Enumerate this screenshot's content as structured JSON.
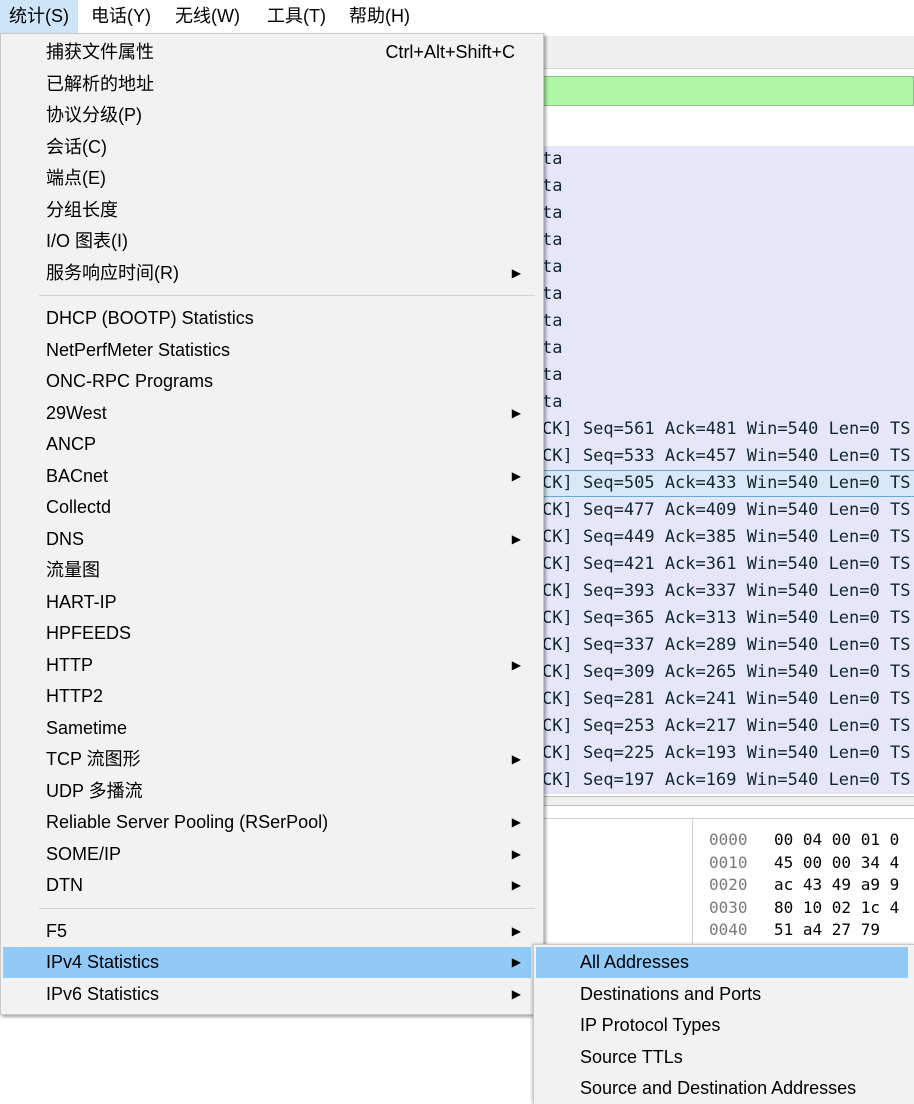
{
  "menubar": {
    "items": [
      {
        "label": "统计(S)",
        "active": true
      },
      {
        "label": "电话(Y)"
      },
      {
        "label": "无线(W)"
      },
      {
        "label": "工具(T)"
      },
      {
        "label": "帮助(H)"
      }
    ]
  },
  "statistics_menu": {
    "groups": [
      [
        {
          "label": "捕获文件属性",
          "shortcut": "Ctrl+Alt+Shift+C"
        },
        {
          "label": "已解析的地址"
        },
        {
          "label": "协议分级(P)"
        },
        {
          "label": "会话(C)"
        },
        {
          "label": "端点(E)"
        },
        {
          "label": "分组长度"
        },
        {
          "label": "I/O 图表(I)"
        },
        {
          "label": "服务响应时间(R)",
          "submenu": true
        }
      ],
      [
        {
          "label": "DHCP (BOOTP) Statistics"
        },
        {
          "label": "NetPerfMeter Statistics"
        },
        {
          "label": "ONC-RPC Programs"
        },
        {
          "label": "29West",
          "submenu": true
        },
        {
          "label": "ANCP"
        },
        {
          "label": "BACnet",
          "submenu": true
        },
        {
          "label": "Collectd"
        },
        {
          "label": "DNS",
          "submenu": true
        },
        {
          "label": "流量图"
        },
        {
          "label": "HART-IP"
        },
        {
          "label": "HPFEEDS"
        },
        {
          "label": "HTTP",
          "submenu": true
        },
        {
          "label": "HTTP2"
        },
        {
          "label": "Sametime"
        },
        {
          "label": "TCP 流图形",
          "submenu": true
        },
        {
          "label": "UDP 多播流"
        },
        {
          "label": "Reliable Server Pooling (RSerPool)",
          "submenu": true
        },
        {
          "label": "SOME/IP",
          "submenu": true
        },
        {
          "label": "DTN",
          "submenu": true
        }
      ],
      [
        {
          "label": "F5",
          "submenu": true
        },
        {
          "label": "IPv4 Statistics",
          "submenu": true,
          "highlighted": true
        },
        {
          "label": "IPv6 Statistics",
          "submenu": true
        }
      ]
    ],
    "submenu_arrow": "▶"
  },
  "ipv4_submenu": {
    "items": [
      {
        "label": "All Addresses",
        "highlighted": true
      },
      {
        "label": "Destinations and Ports"
      },
      {
        "label": "IP Protocol Types"
      },
      {
        "label": "Source TTLs"
      },
      {
        "label": "Source and Destination Addresses"
      }
    ]
  },
  "packet_list": {
    "rows": [
      "ta",
      "ta",
      "ta",
      "ta",
      "ta",
      "ta",
      "ta",
      "ta",
      "ta",
      "ta",
      "CK] Seq=561 Ack=481 Win=540 Len=0 TS",
      "CK] Seq=533 Ack=457 Win=540 Len=0 TS",
      "CK] Seq=505 Ack=433 Win=540 Len=0 TS",
      "CK] Seq=477 Ack=409 Win=540 Len=0 TS",
      "CK] Seq=449 Ack=385 Win=540 Len=0 TS",
      "CK] Seq=421 Ack=361 Win=540 Len=0 TS",
      "CK] Seq=393 Ack=337 Win=540 Len=0 TS",
      "CK] Seq=365 Ack=313 Win=540 Len=0 TS",
      "CK] Seq=337 Ack=289 Win=540 Len=0 TS",
      "CK] Seq=309 Ack=265 Win=540 Len=0 TS",
      "CK] Seq=281 Ack=241 Win=540 Len=0 TS",
      "CK] Seq=253 Ack=217 Win=540 Len=0 TS",
      "CK] Seq=225 Ack=193 Win=540 Len=0 TS",
      "CK] Seq=197 Ack=169 Win=540 Len=0 TS"
    ],
    "selected_index": 12
  },
  "hex_dump": {
    "rows": [
      {
        "offset": "0000",
        "bytes": "00 04 00 01 0"
      },
      {
        "offset": "0010",
        "bytes": "45 00 00 34 4"
      },
      {
        "offset": "0020",
        "bytes": "ac 43 49 a9 9"
      },
      {
        "offset": "0030",
        "bytes": "80 10 02 1c 4"
      },
      {
        "offset": "0040",
        "bytes": "51 a4 27 79"
      }
    ]
  },
  "colors": {
    "menu_bg": "#f2f2f2",
    "highlight": "#91c9f7",
    "filter_bar": "#aef5a6",
    "packet_bg": "#e6e6fa"
  }
}
